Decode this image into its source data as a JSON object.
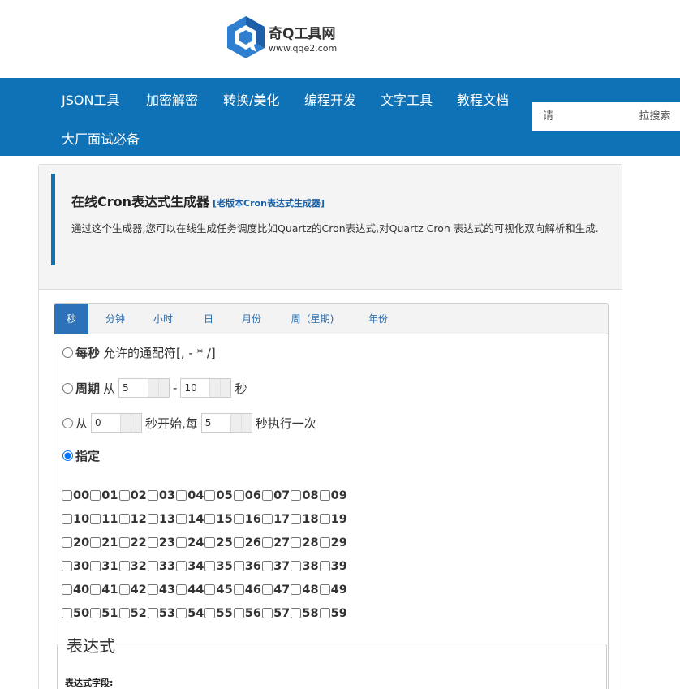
{
  "site": {
    "name": "奇Q工具网",
    "url": "www.qqe2.com",
    "brand_color": "#0f72b6"
  },
  "nav": {
    "items": [
      {
        "label": "JSON工具"
      },
      {
        "label": "加密解密"
      },
      {
        "label": "转换/美化"
      },
      {
        "label": "编程开发"
      },
      {
        "label": "文字工具"
      },
      {
        "label": "教程文档"
      },
      {
        "label": "大厂面试必备"
      }
    ],
    "search": {
      "placeholder": "请",
      "button": "拉搜索"
    }
  },
  "intro": {
    "title": "在线Cron表达式生成器",
    "old_link": "[老版本Cron表达式生成器]",
    "description": "通过这个生成器,您可以在线生成任务调度比如Quartz的Cron表达式,对Quartz Cron 表达式的可视化双向解析和生成."
  },
  "tabs": [
    {
      "label": "秒",
      "active": true
    },
    {
      "label": "分钟"
    },
    {
      "label": "小时"
    },
    {
      "label": "日"
    },
    {
      "label": "月份"
    },
    {
      "label": "周（星期)"
    },
    {
      "label": "年份"
    }
  ],
  "options": {
    "every": {
      "bold": "每秒",
      "text": "允许的通配符[, - * /]"
    },
    "period": {
      "bold": "周期",
      "from": "从",
      "start": "5",
      "dash": "-",
      "end": "10",
      "unit": "秒"
    },
    "interval": {
      "from": "从",
      "start": "0",
      "mid": "秒开始,每",
      "step": "5",
      "tail": "秒执行一次"
    },
    "specify": {
      "bold": "指定",
      "checked": true
    }
  },
  "seconds": [
    [
      "00",
      "01",
      "02",
      "03",
      "04",
      "05",
      "06",
      "07",
      "08",
      "09"
    ],
    [
      "10",
      "11",
      "12",
      "13",
      "14",
      "15",
      "16",
      "17",
      "18",
      "19"
    ],
    [
      "20",
      "21",
      "22",
      "23",
      "24",
      "25",
      "26",
      "27",
      "28",
      "29"
    ],
    [
      "30",
      "31",
      "32",
      "33",
      "34",
      "35",
      "36",
      "37",
      "38",
      "39"
    ],
    [
      "40",
      "41",
      "42",
      "43",
      "44",
      "45",
      "46",
      "47",
      "48",
      "49"
    ],
    [
      "50",
      "51",
      "52",
      "53",
      "54",
      "55",
      "56",
      "57",
      "58",
      "59"
    ]
  ],
  "expression": {
    "legend": "表达式",
    "field_label": "表达式字段:"
  }
}
